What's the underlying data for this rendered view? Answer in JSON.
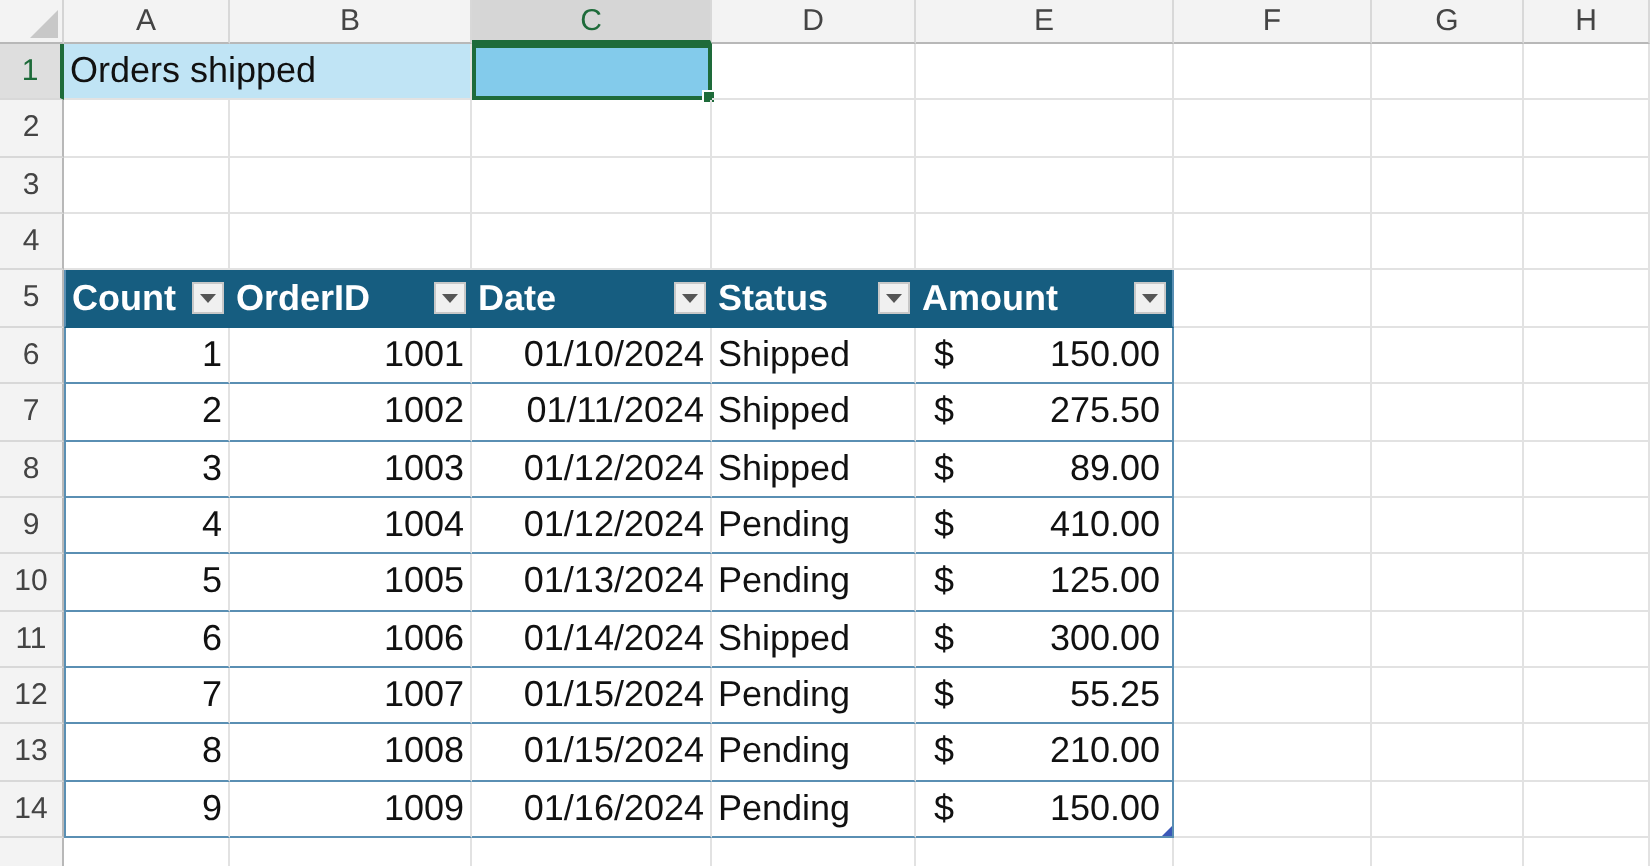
{
  "columns": [
    {
      "label": "A",
      "selected": false
    },
    {
      "label": "B",
      "selected": false
    },
    {
      "label": "C",
      "selected": true
    },
    {
      "label": "D",
      "selected": false
    },
    {
      "label": "E",
      "selected": false
    },
    {
      "label": "F",
      "selected": false
    },
    {
      "label": "G",
      "selected": false
    },
    {
      "label": "H",
      "selected": false
    }
  ],
  "rows": [
    {
      "label": "1",
      "selected": true
    },
    {
      "label": "2",
      "selected": false
    },
    {
      "label": "3",
      "selected": false
    },
    {
      "label": "4",
      "selected": false
    },
    {
      "label": "5",
      "selected": false
    },
    {
      "label": "6",
      "selected": false
    },
    {
      "label": "7",
      "selected": false
    },
    {
      "label": "8",
      "selected": false
    },
    {
      "label": "9",
      "selected": false
    },
    {
      "label": "10",
      "selected": false
    },
    {
      "label": "11",
      "selected": false
    },
    {
      "label": "12",
      "selected": false
    },
    {
      "label": "13",
      "selected": false
    },
    {
      "label": "14",
      "selected": false
    }
  ],
  "title_cell": {
    "text": "Orders shipped"
  },
  "table": {
    "columns": [
      {
        "name": "Count",
        "filter": true
      },
      {
        "name": "OrderID",
        "filter": true
      },
      {
        "name": "Date",
        "filter": true
      },
      {
        "name": "Status",
        "filter": true
      },
      {
        "name": "Amount",
        "filter": true
      }
    ],
    "rows": [
      {
        "count": "1",
        "order_id": "1001",
        "date": "01/10/2024",
        "status": "Shipped",
        "currency": "$",
        "amount": "150.00"
      },
      {
        "count": "2",
        "order_id": "1002",
        "date": "01/11/2024",
        "status": "Shipped",
        "currency": "$",
        "amount": "275.50"
      },
      {
        "count": "3",
        "order_id": "1003",
        "date": "01/12/2024",
        "status": "Shipped",
        "currency": "$",
        "amount": "89.00"
      },
      {
        "count": "4",
        "order_id": "1004",
        "date": "01/12/2024",
        "status": "Pending",
        "currency": "$",
        "amount": "410.00"
      },
      {
        "count": "5",
        "order_id": "1005",
        "date": "01/13/2024",
        "status": "Pending",
        "currency": "$",
        "amount": "125.00"
      },
      {
        "count": "6",
        "order_id": "1006",
        "date": "01/14/2024",
        "status": "Shipped",
        "currency": "$",
        "amount": "300.00"
      },
      {
        "count": "7",
        "order_id": "1007",
        "date": "01/15/2024",
        "status": "Pending",
        "currency": "$",
        "amount": "55.25"
      },
      {
        "count": "8",
        "order_id": "1008",
        "date": "01/15/2024",
        "status": "Pending",
        "currency": "$",
        "amount": "210.00"
      },
      {
        "count": "9",
        "order_id": "1009",
        "date": "01/16/2024",
        "status": "Pending",
        "currency": "$",
        "amount": "150.00"
      }
    ]
  }
}
